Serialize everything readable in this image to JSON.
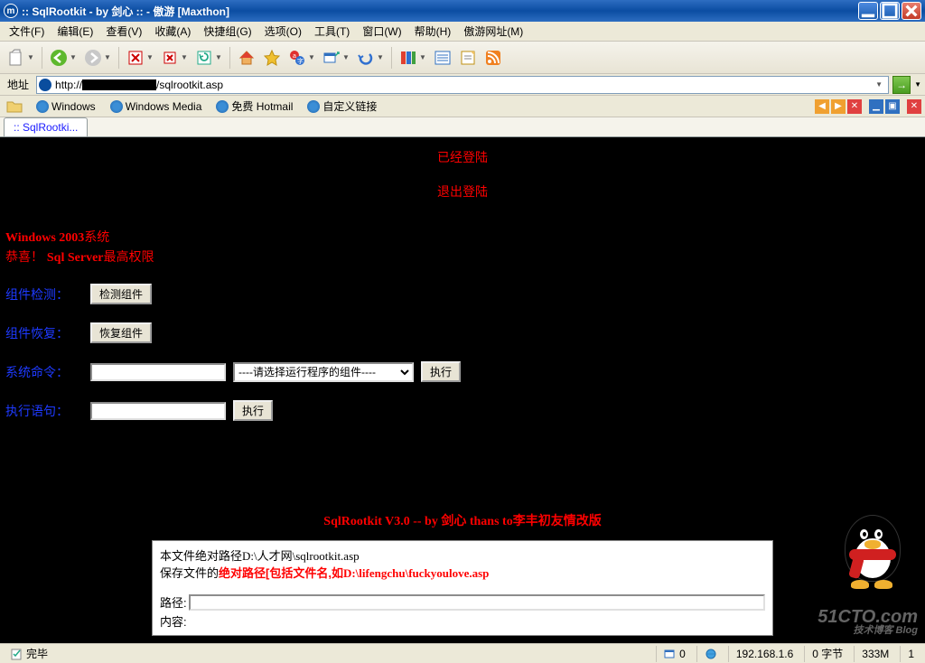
{
  "window": {
    "title": ":: SqlRootkit - by 剑心 :: - 傲游 [Maxthon]"
  },
  "menu": {
    "items": [
      "文件(F)",
      "编辑(E)",
      "查看(V)",
      "收藏(A)",
      "快捷组(G)",
      "选项(O)",
      "工具(T)",
      "窗口(W)",
      "帮助(H)",
      "傲游网址(M)"
    ]
  },
  "address": {
    "label": "地址",
    "prefix": "http://",
    "suffix": "/sqlrootkit.asp"
  },
  "links": {
    "items": [
      "Windows",
      "Windows Media",
      "免费 Hotmail",
      "自定义链接"
    ]
  },
  "tabs": {
    "active": ":: SqlRootki..."
  },
  "page": {
    "loggedin": "已经登陆",
    "logout": "退出登陆",
    "sysinfo_win": "Windows 2003",
    "sysinfo_cn": "系统",
    "congrats_pre": "恭喜！",
    "congrats_sql": "Sql Server",
    "congrats_post": "最高权限",
    "rows": {
      "detect": {
        "label": "组件检测：",
        "btn": "检测组件"
      },
      "recover": {
        "label": "组件恢复：",
        "btn": "恢复组件"
      },
      "cmd": {
        "label": "系统命令：",
        "select_placeholder": "----请选择运行程序的组件----",
        "btn": "执行"
      },
      "exec": {
        "label": "执行语句：",
        "btn": "执行"
      }
    },
    "footer": {
      "a": "SqlRootkit V3.0 -- by ",
      "b": "剑心",
      "c": "    thans to",
      "d": "李丰初",
      "e": "友情改版"
    },
    "filebox": {
      "line1_a": "本文件绝对路径D:\\人才网\\sqlrootkit.asp",
      "line2_a": "保存文件的",
      "line2_b": "绝对路径[包括文件名,如",
      "line2_c": "D:\\lifengchu\\fuckyoulove.asp",
      "path_label": "路径:",
      "content_label": "内容:"
    }
  },
  "watermark": {
    "main": "51CTO.com",
    "sub": "技术博客   Blog"
  },
  "status": {
    "done": "完毕",
    "popups": "0",
    "ip": "192.168.1.6",
    "bytes": "0 字节",
    "mem": "333M",
    "n": "1"
  }
}
